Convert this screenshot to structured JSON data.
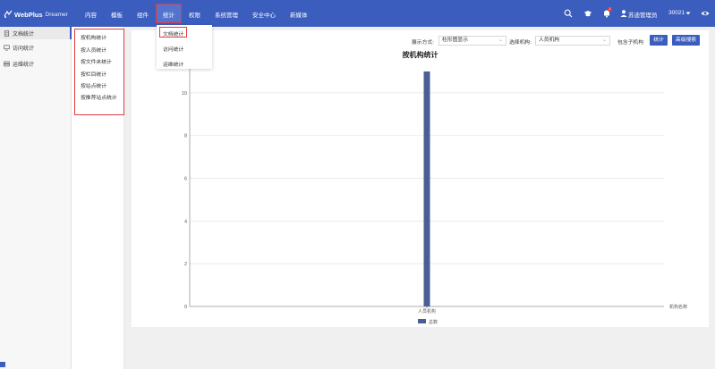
{
  "header": {
    "logo_text": "WebPlus",
    "logo_sub": "Dreamer",
    "nav": [
      {
        "label": "内容",
        "x": 95
      },
      {
        "label": "模板",
        "x": 124
      },
      {
        "label": "组件",
        "x": 153
      },
      {
        "label": "统计",
        "x": 182
      },
      {
        "label": "权限",
        "x": 211
      },
      {
        "label": "系统管理",
        "x": 240
      },
      {
        "label": "安全中心",
        "x": 282
      },
      {
        "label": "新媒体",
        "x": 324
      }
    ],
    "active_nav": "统计",
    "notification_count": "1",
    "user_name": "苏迪管理员",
    "user_id": "30021"
  },
  "dropdown": {
    "items": [
      "文档统计",
      "访问统计",
      "运维统计"
    ]
  },
  "sidebar": {
    "items": [
      "文档统计",
      "访问统计",
      "运维统计"
    ]
  },
  "submenu": {
    "items": [
      "按机构统计",
      "按人员统计",
      "按文件夹统计",
      "按栏目统计",
      "按站点统计",
      "按推荐站点统计"
    ]
  },
  "controls": {
    "display_label": "展示方式:",
    "display_value": "柱形图显示",
    "org_label": "选择机构:",
    "org_value": "人员机构",
    "include_children": "包含子机构",
    "stat_button": "统计",
    "advanced_button": "高级搜索"
  },
  "chart_data": {
    "type": "bar",
    "title": "按机构统计",
    "categories": [
      "人员机构"
    ],
    "series": [
      {
        "name": "总数",
        "values": [
          11
        ]
      }
    ],
    "xlabel": "机构名称",
    "ylabel": "",
    "ylim": [
      0,
      11
    ],
    "yticks": [
      0,
      2,
      4,
      6,
      8,
      10
    ],
    "bar_color": "#4a5d94",
    "grid": true,
    "legend": "bottom-center"
  },
  "colors": {
    "brand": "#3a5dbe",
    "highlight": "#e23b3b"
  }
}
